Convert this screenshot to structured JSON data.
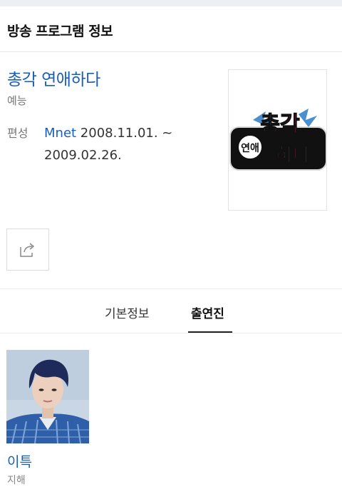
{
  "header": {
    "title": "방송 프로그램 정보"
  },
  "program": {
    "title": "총각 연애하다",
    "genre": "예능",
    "schedule_label": "편성",
    "channel": "Mnet",
    "dates": " 2008.11.01. ~ 2009.02.26.",
    "poster": {
      "text_top": "총각",
      "text_circle": "연애",
      "text_bottom": "하다"
    }
  },
  "share": {
    "icon": "share-icon"
  },
  "tabs": [
    {
      "label": "기본정보",
      "active": false
    },
    {
      "label": "출연진",
      "active": true
    }
  ],
  "cast": [
    {
      "name": "이특",
      "role": "지해"
    }
  ],
  "colors": {
    "link": "#1a5fb4",
    "poster_pink": "#d8286e",
    "poster_black": "#111111"
  }
}
